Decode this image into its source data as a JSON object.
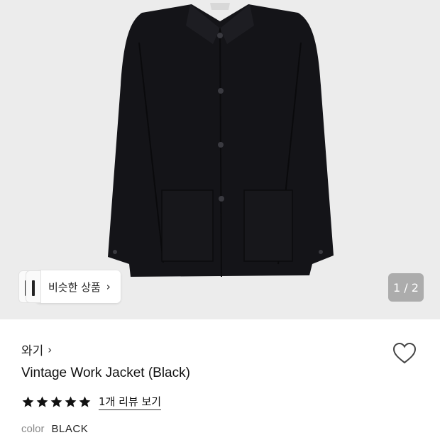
{
  "product": {
    "brand": "와기",
    "title": "Vintage Work Jacket (Black)",
    "rating_stars": 5,
    "review_link": "1개 리뷰 보기",
    "color_label": "color",
    "color_value": "BLACK",
    "wishlisted": false
  },
  "gallery": {
    "similar_label": "비슷한 상품",
    "page_indicator": "1 / 2"
  },
  "colors": {
    "hero_bg": "#ececec",
    "jacket": "#141418",
    "star": "#111111"
  },
  "icons": {
    "chevron": "chevron-right-icon",
    "wish": "heart-outline-icon",
    "star": "star-icon"
  }
}
